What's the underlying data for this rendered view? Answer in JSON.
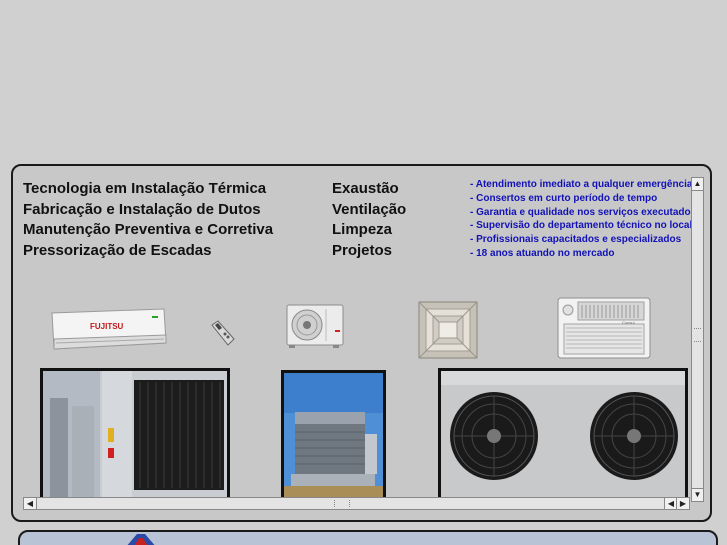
{
  "services_left": [
    "Tecnologia em Instalação Térmica",
    "Fabricação e Instalação de Dutos",
    "Manutenção Preventiva e Corretiva",
    "Pressorização de Escadas"
  ],
  "services_right": [
    "Exaustão",
    "Ventilação",
    "Limpeza",
    "Projetos"
  ],
  "highlights": [
    "- Atendimento imediato a qualquer emergência",
    "- Consertos em curto período de tempo",
    "- Garantia e qualidade nos serviços executados",
    "- Supervisão do departamento técnico no local",
    "- Profissionais capacitados e especializados",
    "- 18 anos atuando no mercado"
  ],
  "brand_label": "FUJITSU",
  "window_unit_label": "Consul",
  "scroll": {
    "up_arrow": "▲",
    "down_arrow": "▼",
    "left_arrow": "◀",
    "right_arrow": "▶"
  },
  "colors": {
    "highlight_text": "#1212b8",
    "panel_border": "#1a1a1a",
    "panel_bg": "#c8c8c8"
  }
}
